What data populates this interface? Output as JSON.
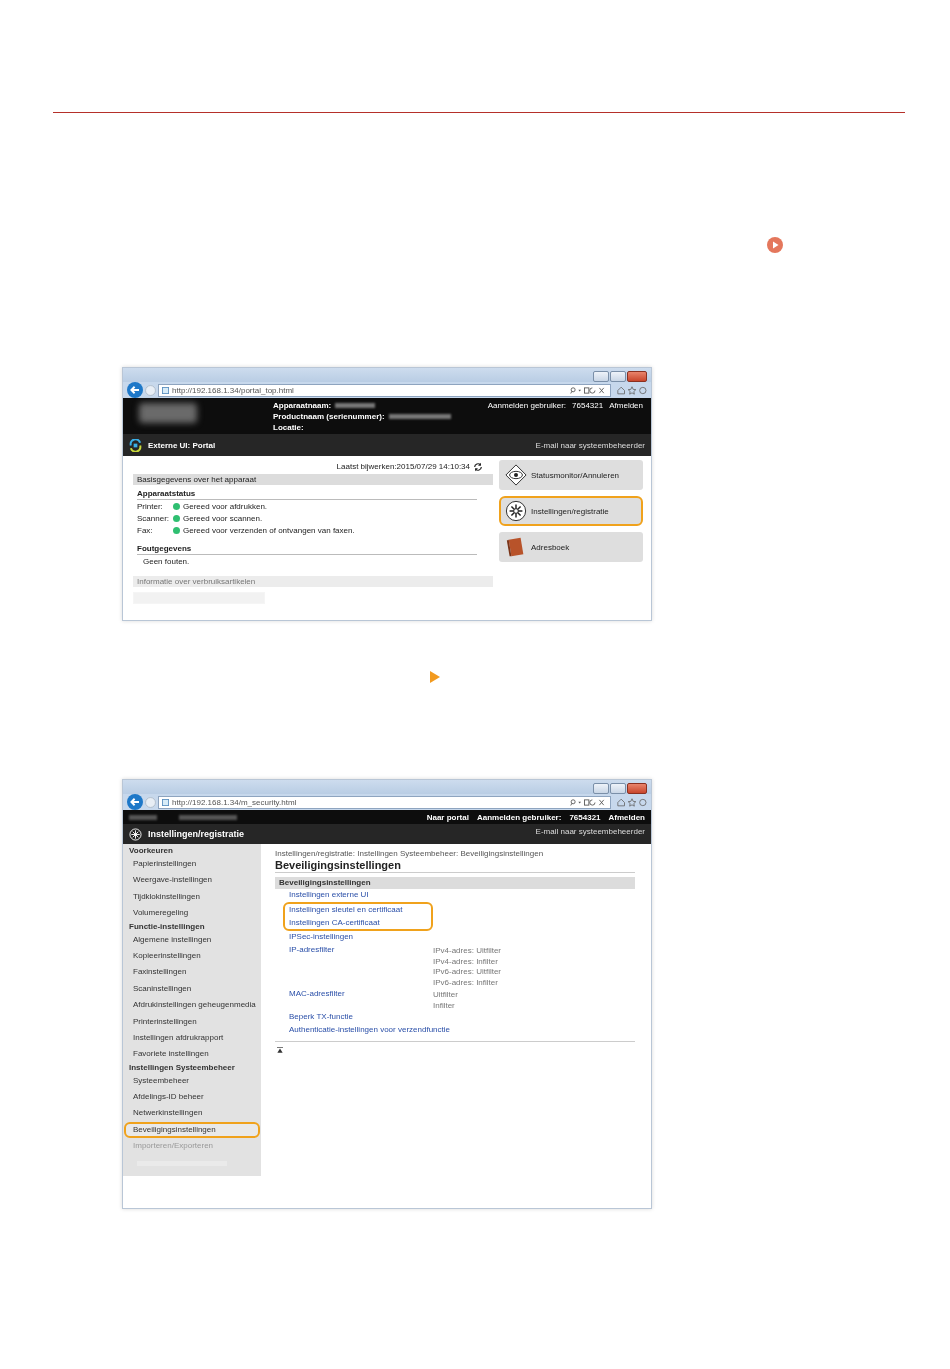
{
  "portal_screenshot": {
    "url": "http://192.168.1.34/portal_top.html",
    "device_labels": [
      "Apparaatnaam:",
      "Productnaam (serienummer):",
      "Locatie:"
    ],
    "user_label": "Aanmelden gebruiker:",
    "user_id": "7654321",
    "logout": "Afmelden",
    "title": "Externe UI: Portal",
    "email_link": "E-mail naar systeembeheerder",
    "last_updated": "Laatst bijwerken:2015/07/29 14:10:34",
    "section_title": "Basisgegevens over het apparaat",
    "status_heading": "Apparaatstatus",
    "statuses": [
      {
        "device": "Printer:",
        "message": "Gereed voor afdrukken.",
        "color": "#2fbf71"
      },
      {
        "device": "Scanner:",
        "message": "Gereed voor scannen.",
        "color": "#2fbf71"
      },
      {
        "device": "Fax:",
        "message": "Gereed voor verzenden of ontvangen van faxen.",
        "color": "#2fbf71"
      }
    ],
    "error_heading": "Foutgegevens",
    "error_text": "Geen fouten.",
    "consumables_title": "Informatie over verbruiksartikelen",
    "menu_buttons": [
      {
        "kind": "status",
        "label": "Statusmonitor/Annuleren",
        "highlighted": false
      },
      {
        "kind": "settings",
        "label": "Instellingen/registratie",
        "highlighted": true
      },
      {
        "kind": "addressbook",
        "label": "Adresboek",
        "highlighted": false
      }
    ]
  },
  "settings_screenshot": {
    "url": "http://192.168.1.34/m_security.html",
    "portal_link": "Naar portal",
    "user_label": "Aanmelden gebruiker:",
    "user_id": "7654321",
    "logout": "Afmelden",
    "title": "Instellingen/registratie",
    "email_link": "E-mail naar systeembeheerder",
    "sidebar": [
      {
        "kind": "header",
        "label": "Voorkeuren"
      },
      {
        "kind": "item",
        "label": "Papierinstellingen",
        "highlighted": false
      },
      {
        "kind": "item",
        "label": "Weergave-instellingen",
        "highlighted": false
      },
      {
        "kind": "item",
        "label": "Tijdklokinstellingen",
        "highlighted": false
      },
      {
        "kind": "item",
        "label": "Volumeregeling",
        "highlighted": false
      },
      {
        "kind": "header",
        "label": "Functie-instellingen"
      },
      {
        "kind": "item",
        "label": "Algemene instellingen",
        "highlighted": false
      },
      {
        "kind": "item",
        "label": "Kopieerinstellingen",
        "highlighted": false
      },
      {
        "kind": "item",
        "label": "Faxinstellingen",
        "highlighted": false
      },
      {
        "kind": "item",
        "label": "Scaninstellingen",
        "highlighted": false
      },
      {
        "kind": "item",
        "label": "Afdrukinstellingen geheugenmedia",
        "highlighted": false
      },
      {
        "kind": "item",
        "label": "Printerinstellingen",
        "highlighted": false
      },
      {
        "kind": "item",
        "label": "Instellingen afdrukrapport",
        "highlighted": false
      },
      {
        "kind": "item",
        "label": "Favoriete instellingen",
        "highlighted": false
      },
      {
        "kind": "header",
        "label": "Instellingen Systeembeheer"
      },
      {
        "kind": "item",
        "label": "Systeembeheer",
        "highlighted": false
      },
      {
        "kind": "item",
        "label": "Afdelings-ID beheer",
        "highlighted": false
      },
      {
        "kind": "item",
        "label": "Netwerkinstellingen",
        "highlighted": false
      },
      {
        "kind": "item",
        "label": "Beveiligingsinstellingen",
        "highlighted": true
      },
      {
        "kind": "faded",
        "label": "Importeren/Exporteren",
        "highlighted": false
      }
    ],
    "breadcrumb": "Instellingen/registratie: Instellingen Systeembeheer: Beveiligingsinstellingen",
    "heading": "Beveiligingsinstellingen",
    "section_title": "Beveiligingsinstellingen",
    "links": [
      {
        "label": "Instellingen externe UI",
        "highlighted": false
      },
      {
        "label": "Instellingen sleutel en certificaat",
        "highlighted": true
      },
      {
        "label": "Instellingen CA-certificaat",
        "highlighted": true
      },
      {
        "label": "IPSec-instellingen",
        "highlighted": false
      },
      {
        "label": "IP-adresfilter",
        "highlighted": false,
        "values": [
          "IPv4-adres: Uitfilter",
          "IPv4-adres: Infilter",
          "IPv6-adres: Uitfilter",
          "IPv6-adres: Infilter"
        ]
      },
      {
        "label": "MAC-adresfilter",
        "highlighted": false,
        "values": [
          "Uitfilter",
          "Infilter"
        ]
      },
      {
        "label": "Beperk TX-functie",
        "highlighted": false
      },
      {
        "label": "Authenticatie-instellingen voor verzendfunctie",
        "highlighted": false
      }
    ]
  }
}
